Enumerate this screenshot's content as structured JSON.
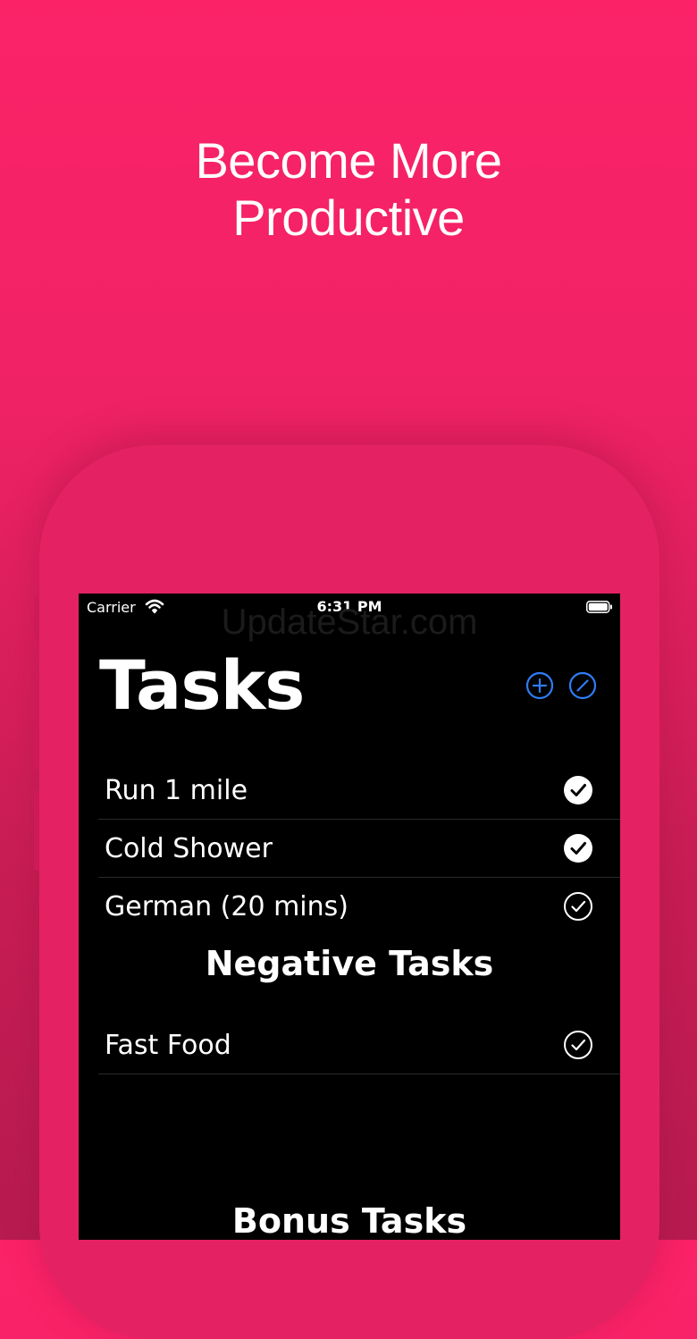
{
  "headline": {
    "line1": "Become More",
    "line2": "Productive"
  },
  "status_bar": {
    "carrier": "Carrier",
    "time": "6:31 PM"
  },
  "watermark": "UpdateStar.com",
  "screen": {
    "title": "Tasks",
    "nav_buttons": [
      {
        "icon": "plus-circle-icon",
        "color": "#2f7cf6"
      },
      {
        "icon": "edit-circle-icon",
        "color": "#2f7cf6"
      }
    ],
    "tasks": [
      {
        "label": "Run 1 mile",
        "completed": true
      },
      {
        "label": "Cold Shower",
        "completed": true
      },
      {
        "label": "German (20 mins)",
        "completed": false
      }
    ],
    "negative_section": {
      "title": "Negative Tasks",
      "items": [
        {
          "label": "Fast Food",
          "completed": false
        }
      ]
    },
    "bonus_section": {
      "title": "Bonus Tasks"
    }
  },
  "colors": {
    "background": "#fb2268",
    "phone_frame": "#e42263",
    "accent": "#2f7cf6",
    "screen_bg": "#000000"
  }
}
